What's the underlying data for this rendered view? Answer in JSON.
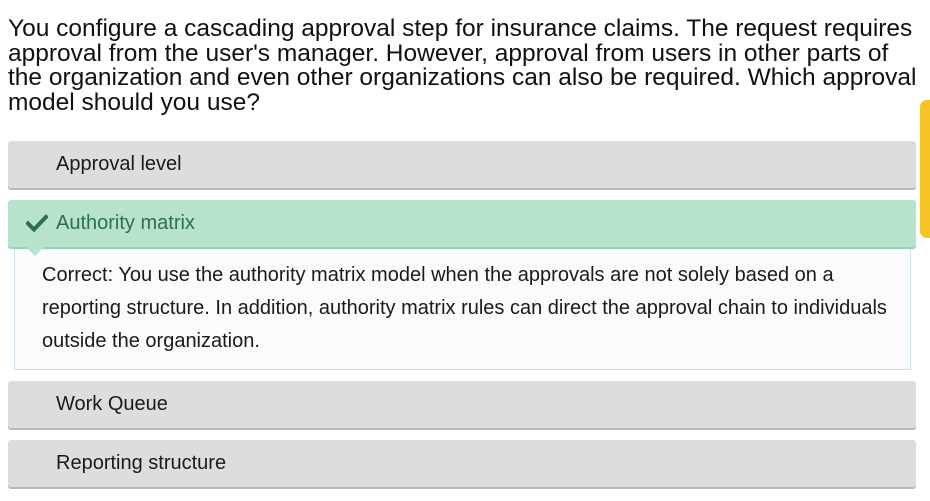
{
  "question": "You configure a cascading approval step for insurance claims. The request requires approval from the user's manager. However, approval from users in other parts of the organization and even other organizations can also be required. Which approval model should you use?",
  "options": [
    {
      "label": "Approval level",
      "state": "unselected"
    },
    {
      "label": "Authority matrix",
      "state": "correct"
    },
    {
      "label": "Work Queue",
      "state": "unselected"
    },
    {
      "label": "Reporting structure",
      "state": "unselected"
    }
  ],
  "feedback": "Correct: You use the authority matrix model when the approvals are not solely based on a reporting structure. In addition, authority matrix rules can direct the approval chain to individuals outside the organization.",
  "icons": {
    "correct_indicator": "checkmark-icon"
  },
  "colors": {
    "option_bg": "#dddddd",
    "correct_bg": "#b5e3cc",
    "correct_text": "#2f6f49",
    "accent_tab": "#f6c327"
  }
}
